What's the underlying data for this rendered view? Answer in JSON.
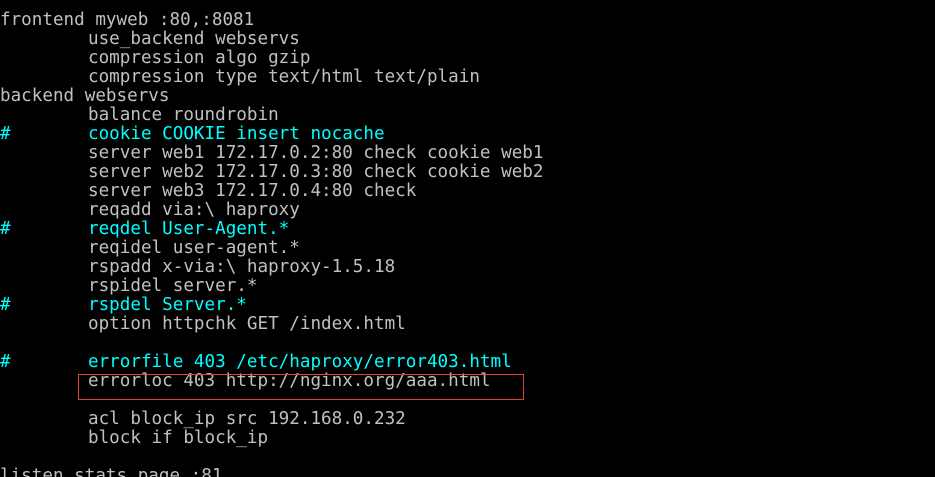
{
  "terminal": {
    "lines": [
      {
        "text": "frontend myweb :80,:8081",
        "comment": false,
        "indent": false
      },
      {
        "text": "use_backend webservs",
        "comment": false,
        "indent": true
      },
      {
        "text": "compression algo gzip",
        "comment": false,
        "indent": true
      },
      {
        "text": "compression type text/html text/plain",
        "comment": false,
        "indent": true
      },
      {
        "text": "backend webservs",
        "comment": false,
        "indent": false
      },
      {
        "text": "balance roundrobin",
        "comment": false,
        "indent": true
      },
      {
        "text": "cookie COOKIE insert nocache",
        "comment": true,
        "indent": true
      },
      {
        "text": "server web1 172.17.0.2:80 check cookie web1",
        "comment": false,
        "indent": true
      },
      {
        "text": "server web2 172.17.0.3:80 check cookie web2",
        "comment": false,
        "indent": true
      },
      {
        "text": "server web3 172.17.0.4:80 check",
        "comment": false,
        "indent": true
      },
      {
        "text": "reqadd via:\\ haproxy",
        "comment": false,
        "indent": true
      },
      {
        "text": "reqdel User-Agent.*",
        "comment": true,
        "indent": true
      },
      {
        "text": "reqidel user-agent.*",
        "comment": false,
        "indent": true
      },
      {
        "text": "rspadd x-via:\\ haproxy-1.5.18",
        "comment": false,
        "indent": true
      },
      {
        "text": "rspidel server.*",
        "comment": false,
        "indent": true
      },
      {
        "text": "rspdel Server.*",
        "comment": true,
        "indent": true
      },
      {
        "text": "option httpchk GET /index.html",
        "comment": false,
        "indent": true
      },
      {
        "text": "",
        "comment": false,
        "indent": false
      },
      {
        "text": "errorfile 403 /etc/haproxy/error403.html",
        "comment": true,
        "indent": true
      },
      {
        "text": "errorloc 403 http://nginx.org/aaa.html",
        "comment": false,
        "indent": true
      },
      {
        "text": "",
        "comment": false,
        "indent": false
      },
      {
        "text": "acl block_ip src 192.168.0.232",
        "comment": false,
        "indent": true
      },
      {
        "text": "block if block_ip",
        "comment": false,
        "indent": true
      },
      {
        "text": "",
        "comment": false,
        "indent": false
      },
      {
        "text": "listen stats page :81",
        "comment": false,
        "indent": false
      }
    ],
    "comment_marker": "#",
    "colors": {
      "background": "#000000",
      "text": "#c0c0c0",
      "comment": "#00ffff",
      "highlight_border": "#e0452c"
    },
    "highlighted_line_index": 19
  }
}
